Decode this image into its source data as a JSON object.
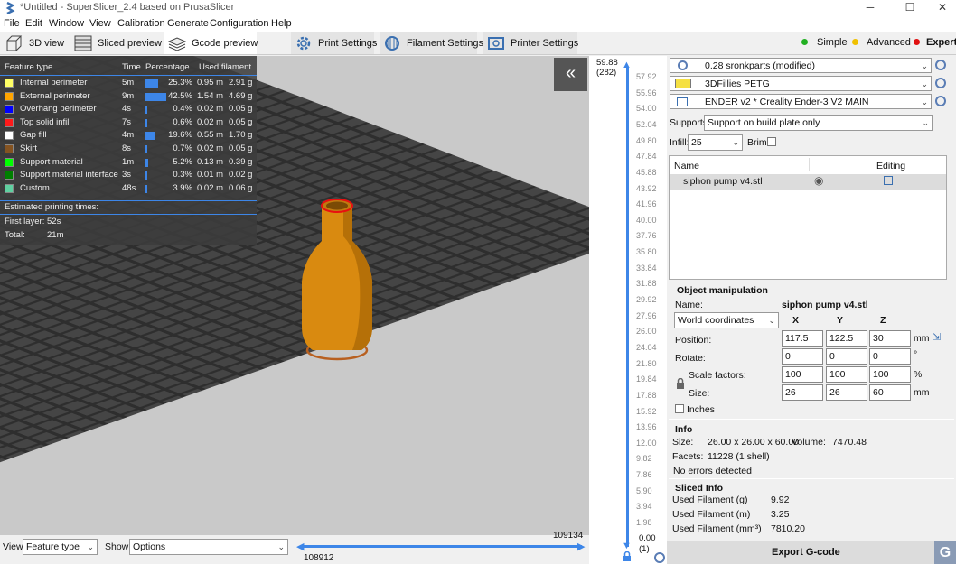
{
  "window": {
    "title": "*Untitled - SuperSlicer_2.4  based on PrusaSlicer",
    "min": "─",
    "max": "☐",
    "close": "✕"
  },
  "menu": [
    "File",
    "Edit",
    "Window",
    "View",
    "Calibration",
    "Generate",
    "Configuration",
    "Help"
  ],
  "tabs": {
    "view3d": "3D view",
    "sliced": "Sliced preview",
    "gcode": "Gcode preview",
    "print": "Print Settings",
    "filament": "Filament Settings",
    "printer": "Printer Settings"
  },
  "modes": {
    "simple": "Simple",
    "advanced": "Advanced",
    "expert": "Expert",
    "colors": {
      "simple": "#22b022",
      "advanced": "#f0c000",
      "expert": "#e01010"
    }
  },
  "legend": {
    "headers": {
      "feature": "Feature type",
      "time": "Time",
      "pct": "Percentage",
      "used": "Used filament"
    },
    "rows": [
      {
        "name": "Internal perimeter",
        "color": "#ffff66",
        "time": "5m",
        "pct": "25.3%",
        "frac": 0.253,
        "m": "0.95 m",
        "g": "2.91 g"
      },
      {
        "name": "External perimeter",
        "color": "#ffa500",
        "time": "9m",
        "pct": "42.5%",
        "frac": 0.425,
        "m": "1.54 m",
        "g": "4.69 g"
      },
      {
        "name": "Overhang perimeter",
        "color": "#0000ff",
        "time": "4s",
        "pct": "0.4%",
        "frac": 0.004,
        "m": "0.02 m",
        "g": "0.05 g"
      },
      {
        "name": "Top solid infill",
        "color": "#ff1a1a",
        "time": "7s",
        "pct": "0.6%",
        "frac": 0.006,
        "m": "0.02 m",
        "g": "0.05 g"
      },
      {
        "name": "Gap fill",
        "color": "#ffffff",
        "time": "4m",
        "pct": "19.6%",
        "frac": 0.196,
        "m": "0.55 m",
        "g": "1.70 g"
      },
      {
        "name": "Skirt",
        "color": "#845321",
        "time": "8s",
        "pct": "0.7%",
        "frac": 0.007,
        "m": "0.02 m",
        "g": "0.05 g"
      },
      {
        "name": "Support material",
        "color": "#00ff00",
        "time": "1m",
        "pct": "5.2%",
        "frac": 0.052,
        "m": "0.13 m",
        "g": "0.39 g"
      },
      {
        "name": "Support material interface",
        "color": "#008000",
        "time": "3s",
        "pct": "0.3%",
        "frac": 0.003,
        "m": "0.01 m",
        "g": "0.02 g"
      },
      {
        "name": "Custom",
        "color": "#5fd0a0",
        "time": "48s",
        "pct": "3.9%",
        "frac": 0.039,
        "m": "0.02 m",
        "g": "0.06 g"
      }
    ],
    "est_label": "Estimated printing times:",
    "first_layer_label": "First layer:",
    "first_layer": "52s",
    "total_label": "Total:",
    "total": "21m"
  },
  "bottom": {
    "view_label": "View",
    "view_value": "Feature type",
    "show_label": "Show",
    "show_value": "Options",
    "hslider_max": "109134",
    "hslider_min": "108912"
  },
  "vslider": {
    "top_value": "59.88",
    "top_layer": "(282)",
    "bottom_value": "0.00",
    "bottom_layer": "(1)",
    "ticks": [
      "57.92",
      "55.96",
      "54.00",
      "52.04",
      "49.80",
      "47.84",
      "45.88",
      "43.92",
      "41.96",
      "40.00",
      "37.76",
      "35.80",
      "33.84",
      "31.88",
      "29.92",
      "27.96",
      "26.00",
      "24.04",
      "21.80",
      "19.84",
      "17.88",
      "15.92",
      "13.96",
      "12.00",
      "9.82",
      "7.86",
      "5.90",
      "3.94",
      "1.98"
    ]
  },
  "presets": {
    "print": "0.28 sronkparts (modified)",
    "filament": "3DFillies PETG",
    "printer": "ENDER v2 * Creality Ender-3 V2 MAIN",
    "filament_color": "#f5e043"
  },
  "supports": {
    "label": "Supports:",
    "value": "Support on build plate only"
  },
  "infill": {
    "label": "Infill:",
    "value": "25",
    "brim_label": "Brim:"
  },
  "objects": {
    "col_name": "Name",
    "col_editing": "Editing",
    "items": [
      "siphon pump v4.stl"
    ]
  },
  "manip": {
    "title": "Object manipulation",
    "name_label": "Name:",
    "name_value": "siphon pump v4.stl",
    "coords": "World coordinates",
    "x": "X",
    "y": "Y",
    "z": "Z",
    "pos_label": "Position:",
    "pos": [
      "117.5",
      "122.5",
      "30"
    ],
    "pos_unit": "mm",
    "rot_label": "Rotate:",
    "rot": [
      "0",
      "0",
      "0"
    ],
    "rot_unit": "°",
    "scale_label": "Scale factors:",
    "scale": [
      "100",
      "100",
      "100"
    ],
    "scale_unit": "%",
    "size_label": "Size:",
    "size": [
      "26",
      "26",
      "60"
    ],
    "size_unit": "mm",
    "inches_label": "Inches"
  },
  "info": {
    "title": "Info",
    "size_label": "Size:",
    "size": "26.00 x 26.00 x 60.00",
    "volume_label": "Volume:",
    "volume": "7470.48",
    "facets_label": "Facets:",
    "facets": "11228 (1 shell)",
    "errors": "No errors detected"
  },
  "sliced": {
    "title": "Sliced Info",
    "g_label": "Used Filament (g)",
    "g": "9.92",
    "m_label": "Used Filament (m)",
    "m": "3.25",
    "mm3_label": "Used Filament (mm³)",
    "mm3": "7810.20"
  },
  "export": {
    "label": "Export G-code"
  }
}
